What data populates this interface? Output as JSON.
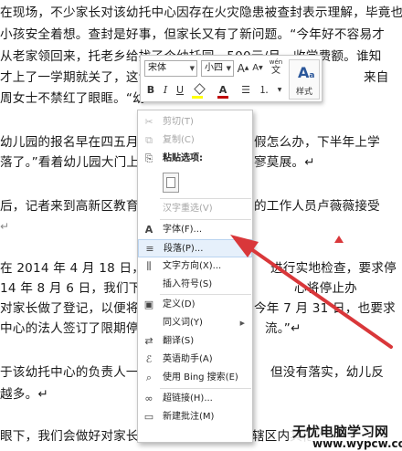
{
  "document": {
    "lines": [
      "在现场，不少家长对该幼托中心因存在火灾隐患被查封表示理解，毕竟也",
      "小孩安全着想。查封是好事，但家长又有了新问题。“今年好不容易才",
      "从老家领回来，托老乡给找了个幼托园，500元/月，收学费额。谁知",
      "才上了一学期就关了，这让",
      "周女士不禁红了眼眶。“幼",
      "幼儿园的报名早在四五月份",
      "落了。”看着幼儿园大门上",
      "后，记者来到高新区教育文",
      "↵",
      "在 2014 年 4 月 18 日，我们",
      "14 年 8 月 6 日，我们下发了",
      "对家长做了登记，以便将来",
      "中心的法人签订了限期停办",
      "于该幼托中心的负责人一拖",
      "越多。↵",
      "眼下，我们会做好对家长的解释工作，并提供辖区内其他幼"
    ],
    "right_fragments": [
      "来自",
      "假怎么办，下半年上学",
      "寥莫展。↵",
      "的工作人员卢薇薇接受",
      "进行实地检查，要求停",
      "心将停止办",
      "今年 7 月 31 日，也要求",
      "流。”↵",
      "但没有落实，幼儿反"
    ]
  },
  "mini_toolbar": {
    "font_name": "宋体",
    "font_size": "小四",
    "grow_font": "A",
    "shrink_font": "A",
    "pinyin": "wén",
    "styles_label": "样式",
    "bold": "B",
    "italic": "I",
    "underline": "U",
    "font_color": "A"
  },
  "context_menu": {
    "items": [
      {
        "label": "剪切(T)",
        "icon": "scissors-icon",
        "glyph": "✂",
        "disabled": true
      },
      {
        "label": "复制(C)",
        "icon": "copy-icon",
        "glyph": "⧉",
        "disabled": true
      },
      {
        "label": "粘贴选项:",
        "icon": "paste-icon",
        "glyph": "📋",
        "disabled": false
      },
      {
        "label": "汉字重选(V)",
        "icon": "",
        "glyph": "",
        "disabled": true
      },
      {
        "label": "字体(F)...",
        "icon": "font-icon",
        "glyph": "A",
        "disabled": false
      },
      {
        "label": "段落(P)...",
        "icon": "paragraph-icon",
        "glyph": "≡",
        "disabled": false
      },
      {
        "label": "文字方向(X)...",
        "icon": "text-direction-icon",
        "glyph": "⫼",
        "disabled": false
      },
      {
        "label": "插入符号(S)",
        "icon": "",
        "glyph": "",
        "disabled": false
      },
      {
        "label": "定义(D)",
        "icon": "define-icon",
        "glyph": "▣",
        "disabled": false
      },
      {
        "label": "同义词(Y)",
        "icon": "",
        "glyph": "",
        "disabled": false
      },
      {
        "label": "翻译(S)",
        "icon": "translate-icon",
        "glyph": "⇄",
        "disabled": false
      },
      {
        "label": "英语助手(A)",
        "icon": "english-assistant-icon",
        "glyph": "ℰ",
        "disabled": false
      },
      {
        "label": "使用 Bing 搜索(E)",
        "icon": "bing-search-icon",
        "glyph": "⌕",
        "disabled": false
      },
      {
        "label": "超链接(H)...",
        "icon": "hyperlink-icon",
        "glyph": "🔗",
        "disabled": false
      },
      {
        "label": "新建批注(M)",
        "icon": "new-comment-icon",
        "glyph": "🗨",
        "disabled": false
      }
    ]
  },
  "watermark": {
    "line1": "无忧电脑学习网",
    "line2": "www.wypcw.com"
  },
  "colors": {
    "accent_red": "#d9373a",
    "highlight": "#e6f0fb",
    "font_color_swatch": "#c00000",
    "highlight_swatch": "#ffff00"
  }
}
